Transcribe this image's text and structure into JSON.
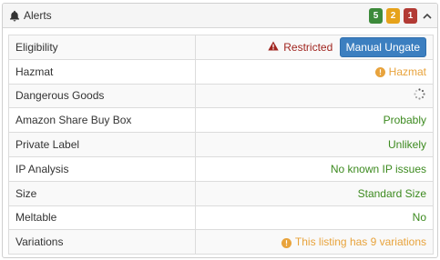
{
  "header": {
    "title": "Alerts",
    "icon": "bell-icon",
    "badges": [
      {
        "value": "5",
        "color": "#3c8a3a"
      },
      {
        "value": "2",
        "color": "#e6a21a"
      },
      {
        "value": "1",
        "color": "#b23a34"
      }
    ],
    "collapse_icon": "chevron-up-icon"
  },
  "rows": [
    {
      "label": "Eligibility",
      "status": "Restricted",
      "status_color": "#a0251f",
      "icon": "warning-icon",
      "button": "Manual Ungate"
    },
    {
      "label": "Hazmat",
      "value": "Hazmat",
      "value_color": "#e8a33c",
      "icon": "info-circle-icon"
    },
    {
      "label": "Dangerous Goods",
      "icon": "loading-spinner-icon"
    },
    {
      "label": "Amazon Share Buy Box",
      "value": "Probably",
      "value_color": "#3c8a1f"
    },
    {
      "label": "Private Label",
      "value": "Unlikely",
      "value_color": "#3c8a1f"
    },
    {
      "label": "IP Analysis",
      "value": "No known IP issues",
      "value_color": "#3c8a1f"
    },
    {
      "label": "Size",
      "value": "Standard Size",
      "value_color": "#3c8a1f"
    },
    {
      "label": "Meltable",
      "value": "No",
      "value_color": "#3c8a1f"
    },
    {
      "label": "Variations",
      "value": "This listing has 9 variations",
      "value_color": "#e8a33c",
      "icon": "info-circle-icon"
    }
  ]
}
